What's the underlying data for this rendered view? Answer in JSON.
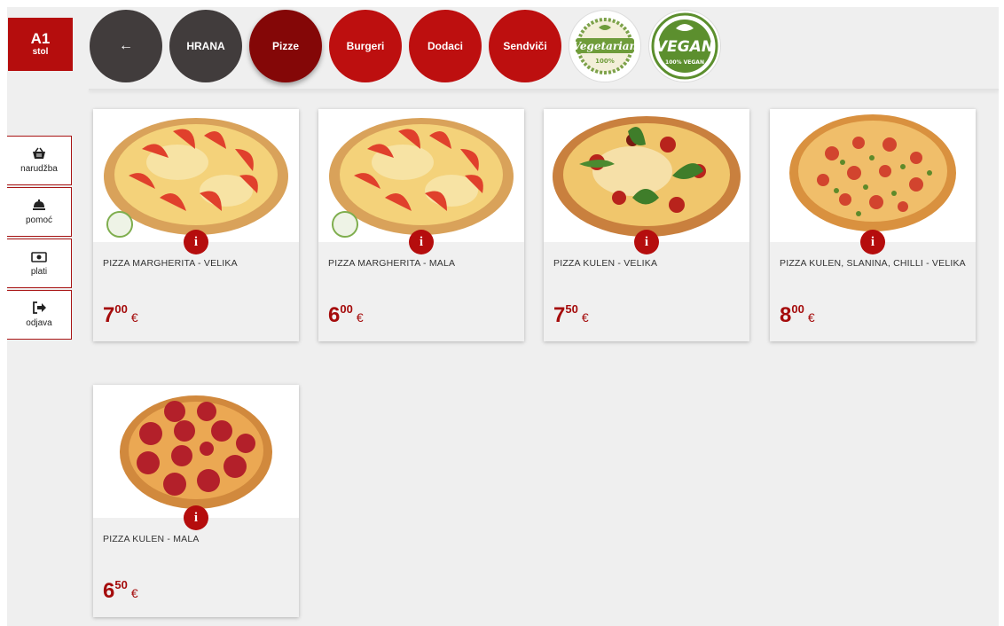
{
  "table": {
    "number": "A1",
    "label": "stol"
  },
  "nav": {
    "back_label": "←",
    "items": [
      {
        "label": "HRANA",
        "style": "dark"
      },
      {
        "label": "Pizze",
        "style": "active"
      },
      {
        "label": "Burgeri",
        "style": "red"
      },
      {
        "label": "Dodaci",
        "style": "red"
      },
      {
        "label": "Sendviči",
        "style": "red"
      }
    ],
    "badges": [
      {
        "text": "Vegetarian",
        "sub": "100%",
        "icon": "vegetarian-badge-icon"
      },
      {
        "text": "VEGAN",
        "sub": "100% VEGAN",
        "icon": "vegan-badge-icon"
      }
    ]
  },
  "sidebar": {
    "items": [
      {
        "label": "narudžba",
        "icon": "basket-icon"
      },
      {
        "label": "pomoć",
        "icon": "service-bell-icon"
      },
      {
        "label": "plati",
        "icon": "banknote-icon"
      },
      {
        "label": "odjava",
        "icon": "logout-icon"
      }
    ]
  },
  "info_label": "i",
  "products": [
    {
      "name": "PIZZA MARGHERITA - VELIKA",
      "euros": "7",
      "cents": "00",
      "currency": "€",
      "image": "margherita-pizza",
      "vegetarian": true
    },
    {
      "name": "PIZZA MARGHERITA - MALA",
      "euros": "6",
      "cents": "00",
      "currency": "€",
      "image": "margherita-pizza",
      "vegetarian": true
    },
    {
      "name": "PIZZA KULEN - VELIKA",
      "euros": "7",
      "cents": "50",
      "currency": "€",
      "image": "kulen-basil-pizza",
      "vegetarian": false
    },
    {
      "name": "PIZZA KULEN, SLANINA, CHILLI - VELIKA",
      "euros": "8",
      "cents": "00",
      "currency": "€",
      "image": "kulen-chilli-pizza",
      "vegetarian": false
    },
    {
      "name": "PIZZA KULEN - MALA",
      "euros": "6",
      "cents": "50",
      "currency": "€",
      "image": "pepperoni-pizza",
      "vegetarian": false
    }
  ],
  "colors": {
    "brand_red": "#bd0f0f",
    "active_red": "#840707",
    "dark": "#413c3c",
    "price_red": "#a50c0c"
  }
}
